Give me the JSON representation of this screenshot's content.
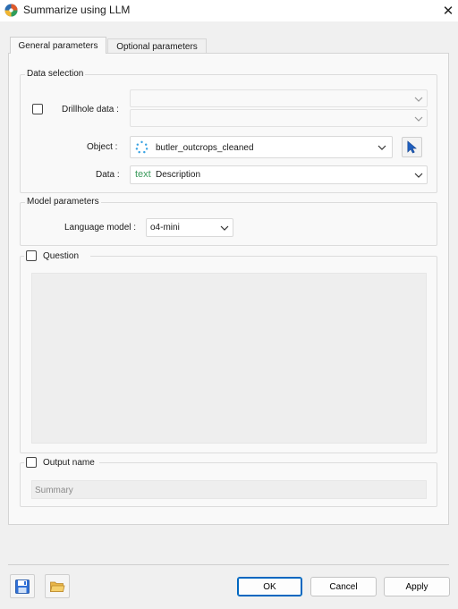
{
  "window": {
    "title": "Summarize using LLM"
  },
  "tabs": [
    {
      "label": "General parameters"
    },
    {
      "label": "Optional parameters"
    }
  ],
  "data_selection": {
    "title": "Data selection",
    "drillhole_label": "Drillhole data :",
    "object_label": "Object :",
    "object_value": "butler_outcrops_cleaned",
    "data_label": "Data :",
    "data_type_badge": "text",
    "data_value": "Description"
  },
  "model_parameters": {
    "title": "Model parameters",
    "language_model_label": "Language model :",
    "language_model_value": "o4-mini"
  },
  "question": {
    "label": "Question",
    "value": ""
  },
  "output": {
    "label": "Output name",
    "placeholder": "Summary"
  },
  "footer": {
    "ok": "OK",
    "cancel": "Cancel",
    "apply": "Apply"
  },
  "colors": {
    "accent": "#0067c0",
    "text_badge": "#3a9a5b",
    "point_icon": "#3aa3e3"
  }
}
